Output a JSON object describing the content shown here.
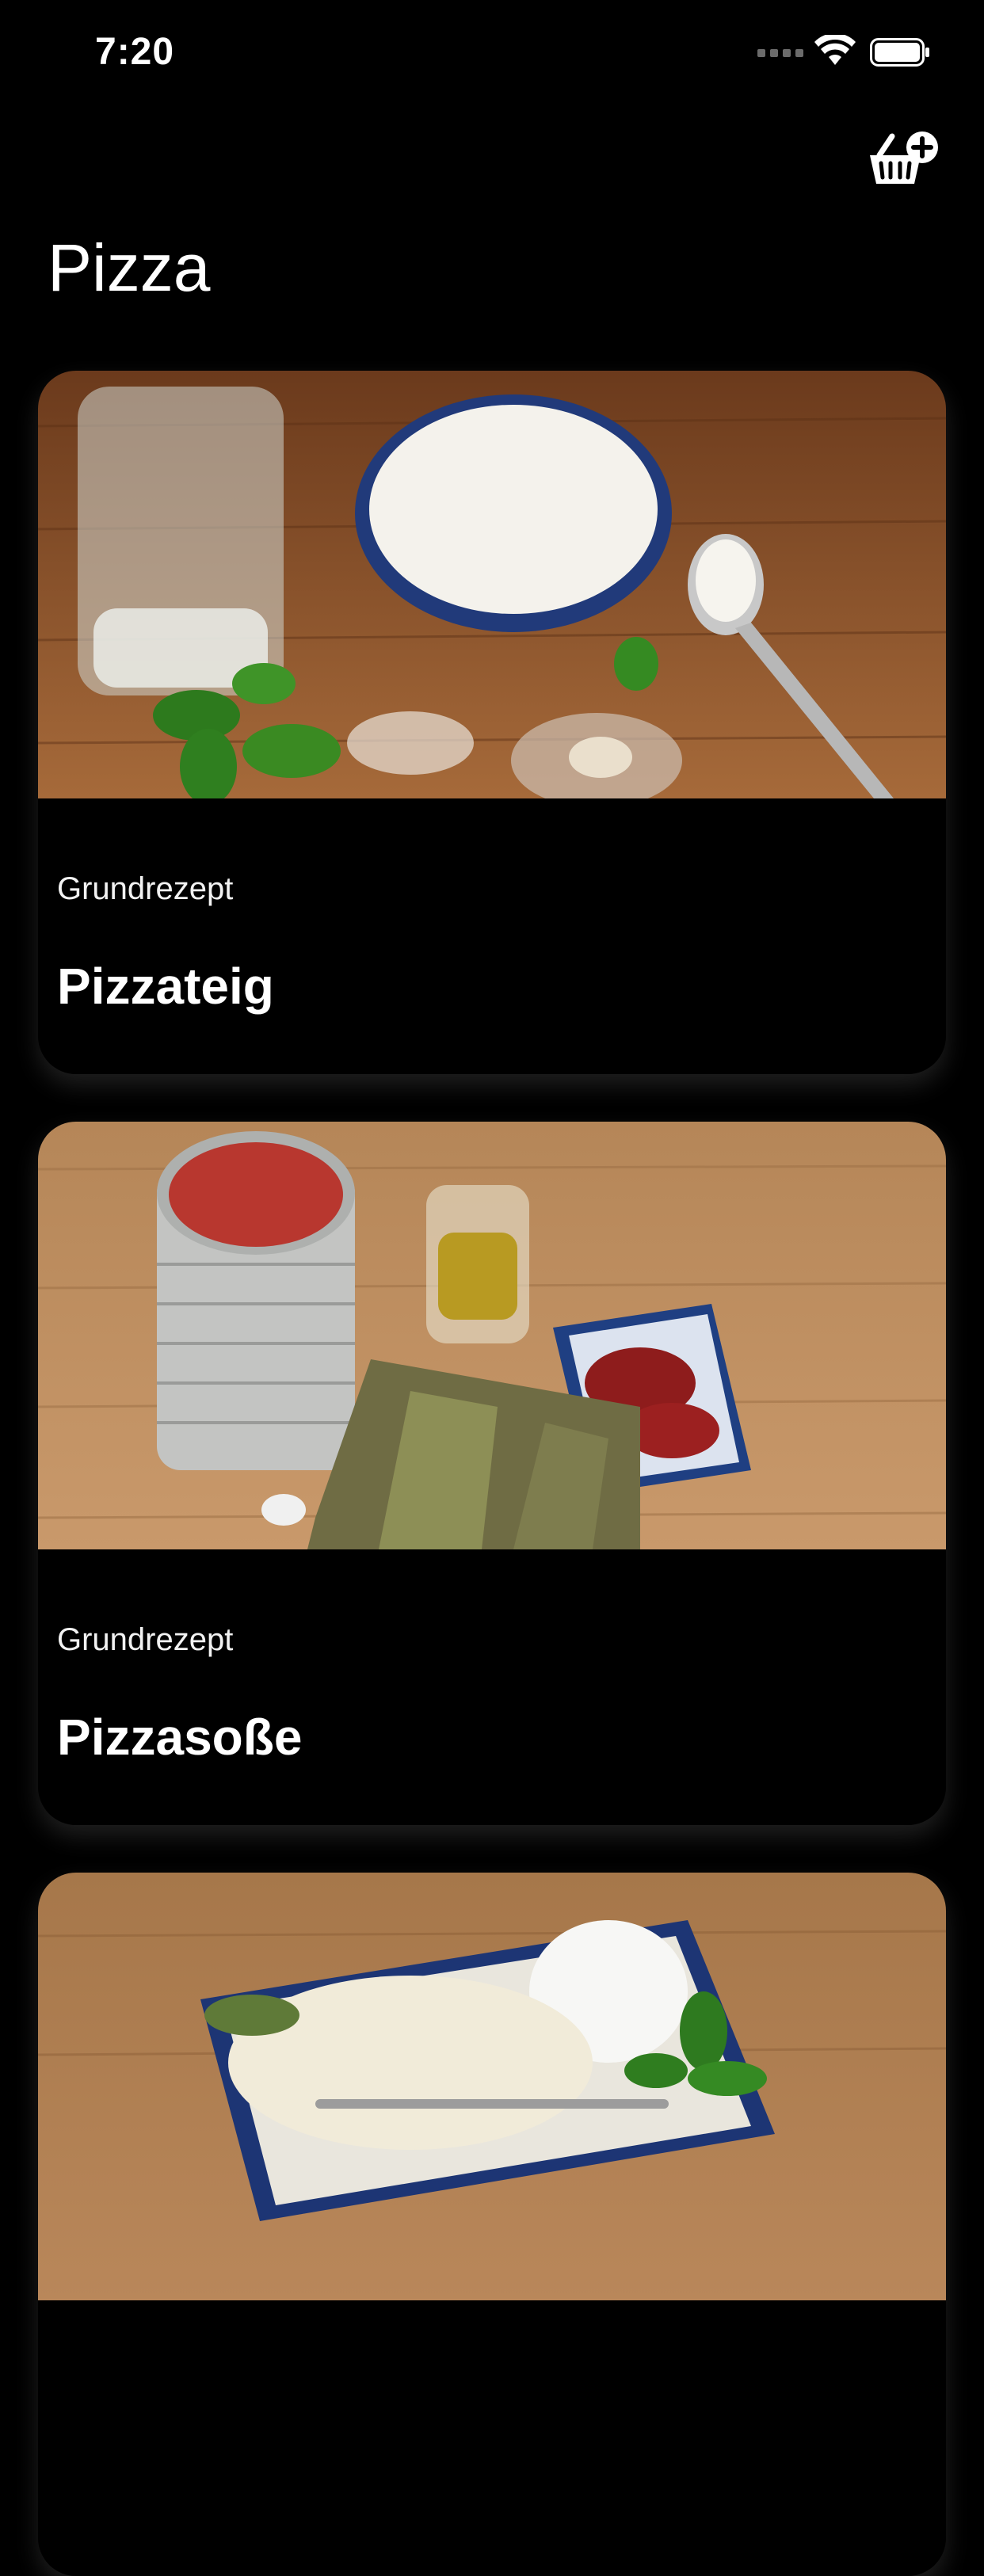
{
  "status_bar": {
    "time": "7:20"
  },
  "nav": {
    "basket_icon": "basket-plus-icon"
  },
  "page": {
    "title": "Pizza"
  },
  "cards": [
    {
      "category": "Grundrezept",
      "title": "Pizzateig",
      "image": "pizza-dough-ingredients"
    },
    {
      "category": "Grundrezept",
      "title": "Pizzasoße",
      "image": "pizza-sauce-ingredients"
    },
    {
      "category": "",
      "title": "",
      "image": "cheese-plate"
    }
  ],
  "colors": {
    "background": "#000000",
    "text": "#ffffff",
    "wood": "#b58658"
  }
}
